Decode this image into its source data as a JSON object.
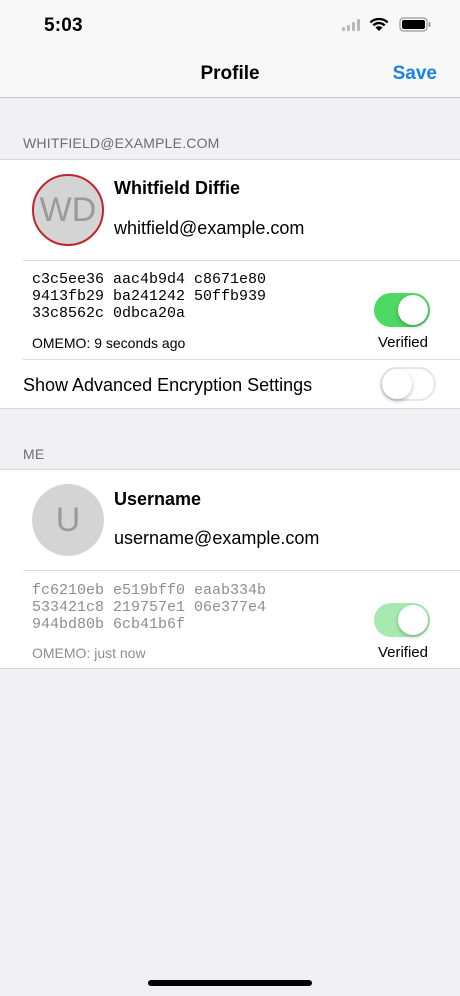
{
  "status": {
    "time": "5:03"
  },
  "nav": {
    "title": "Profile",
    "save_label": "Save"
  },
  "contact": {
    "section_header": "WHITFIELD@EXAMPLE.COM",
    "initials": "WD",
    "name": "Whitfield Diffie",
    "email": "whitfield@example.com",
    "fingerprint": "c3c5ee36 aac4b9d4 c8671e80\n9413fb29 ba241242 50ffb939\n33c8562c 0dbca20a",
    "omemo_status": "OMEMO: 9 seconds ago",
    "verified_label": "Verified",
    "verified": true,
    "advanced_label": "Show Advanced Encryption Settings",
    "advanced_enabled": false
  },
  "me": {
    "section_header": "ME",
    "initials": "U",
    "name": "Username",
    "email": "username@example.com",
    "fingerprint": "fc6210eb e519bff0 eaab334b\n533421c8 219757e1 06e377e4\n944bd80b 6cb41b6f",
    "omemo_status": "OMEMO: just now",
    "verified_label": "Verified",
    "verified": true
  },
  "colors": {
    "accent": "#1a82e2",
    "switch_on": "#4cd964",
    "avatar_ring": "#c0252a"
  }
}
